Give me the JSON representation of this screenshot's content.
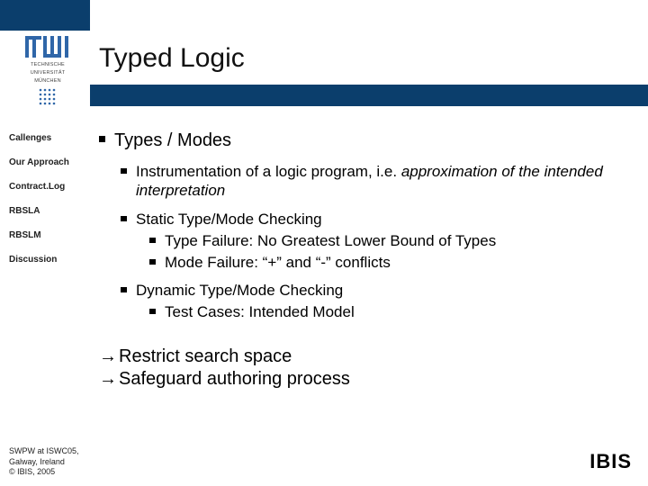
{
  "header": {
    "title": "Typed Logic",
    "logo_caption_l1": "TECHNISCHE",
    "logo_caption_l2": "UNIVERSITÄT",
    "logo_caption_l3": "MÜNCHEN"
  },
  "sidebar": {
    "items": [
      "Callenges",
      "Our Approach",
      "Contract.Log",
      "RBSLA",
      "RBSLM",
      "Discussion"
    ]
  },
  "content": {
    "heading": "Types / Modes",
    "b1_pre": "Instrumentation of a logic program, i.e. ",
    "b1_em": "approximation of the intended interpretation",
    "b2": "Static Type/Mode Checking",
    "b2a": "Type Failure: No Greatest Lower Bound of Types",
    "b2b": "Mode Failure: “+” and “-” conflicts",
    "b3": "Dynamic Type/Mode Checking",
    "b3a": "Test Cases: Intended Model",
    "c1": "Restrict search space",
    "c2": "Safeguard authoring process"
  },
  "footer": {
    "l1": "SWPW at ISWC05,",
    "l2": "Galway, Ireland",
    "l3": "© IBIS, 2005",
    "logo": "IBIS"
  }
}
